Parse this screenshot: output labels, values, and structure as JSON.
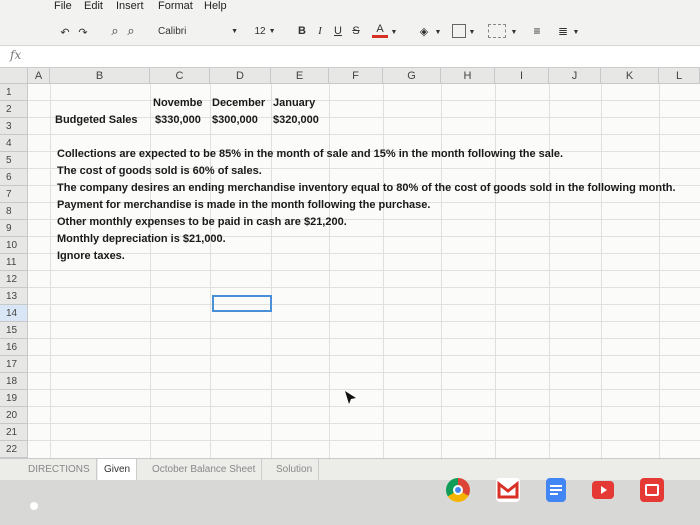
{
  "menubar": {
    "items": [
      "File",
      "Edit",
      "Insert",
      "Format",
      "Help"
    ]
  },
  "toolbar": {
    "font_name": "Calibri",
    "font_size": "12",
    "bold": "B",
    "italic": "I",
    "underline": "U",
    "strike": "S",
    "text_color": "A"
  },
  "formula": {
    "fx": "fx"
  },
  "columns": [
    "A",
    "B",
    "C",
    "D",
    "E",
    "F",
    "G",
    "H",
    "I",
    "J",
    "K",
    "L"
  ],
  "rows": [
    "1",
    "2",
    "3",
    "4",
    "5",
    "6",
    "7",
    "8",
    "9",
    "10",
    "11",
    "12",
    "13",
    "14",
    "15",
    "16",
    "17",
    "18",
    "19",
    "20",
    "21",
    "22"
  ],
  "cells": {
    "c2": "Novembe",
    "d2": "December",
    "e2": "January",
    "b3": "Budgeted Sales",
    "c3": "$330,000",
    "d3": "$300,000",
    "e3": "$320,000",
    "notes": [
      "Collections are expected to be 85% in the month of sale and 15% in the month following the sale.",
      "The cost of goods sold is 60% of sales.",
      "The company desires an ending merchandise inventory equal to 80% of the cost of goods sold in the following month.",
      "Payment for merchandise is made in the month following the purchase.",
      "Other monthly expenses to be paid in cash are $21,200.",
      "Monthly depreciation is $21,000.",
      "Ignore taxes."
    ]
  },
  "tabs": [
    "DIRECTIONS",
    "Given",
    "October Balance Sheet",
    "Solution"
  ],
  "active_tab": "Given",
  "colors": {
    "selection": "#4a90d9",
    "grid": "#e0e0de"
  },
  "shelf_apps": [
    "chrome-icon",
    "gmail-icon",
    "docs-icon",
    "youtube-icon",
    "files-icon"
  ]
}
